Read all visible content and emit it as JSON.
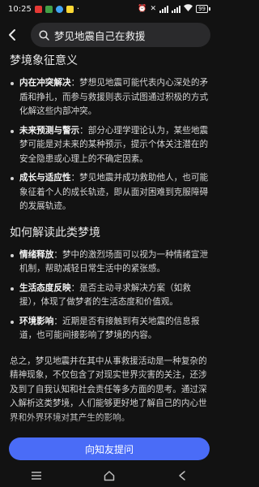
{
  "status": {
    "time": "10:25",
    "battery": "99"
  },
  "search": {
    "query": "梦见地震自己在救援"
  },
  "section1": {
    "title": "梦境象征意义",
    "items": [
      {
        "label": "内在冲突解决",
        "text": "：梦想见地震可能代表内心深处的矛盾和挣扎，而参与救援则表示试图通过积极的方式化解这些内部冲突。"
      },
      {
        "label": "未来预测与警示",
        "text": "：部分心理学理论认为，某些地震梦可能是对未来的某种预示，提示个体关注潜在的安全隐患或心理上的不确定因素。"
      },
      {
        "label": "成长与适应性",
        "text": "：梦见地震并成功救助他人，也可能象征着个人的成长轨迹，即从面对困难到克服障碍的发展轨迹。"
      }
    ]
  },
  "section2": {
    "title": "如何解读此类梦境",
    "items": [
      {
        "label": "情绪释放",
        "text": "：梦中的激烈场面可以视为一种情绪宣泄机制，帮助减轻日常生活中的紧张感。"
      },
      {
        "label": "生活态度反映",
        "text": "：是否主动寻求解决方案（如救援），体现了做梦者的生活态度和价值观。"
      },
      {
        "label": "环境影响",
        "text": "：近期是否有接触到有关地震的信息报道，也可能间接影响了梦境的内容。"
      }
    ]
  },
  "summary": "总之，梦见地震并在其中从事救援活动是一种复杂的精神现象，不仅包含了对现实世界灾害的关注，还涉及到了自我认知和社会责任等多方面的思考。通过深入解析这类梦境，人们能够更好地了解自己的内心世界和外界环境对其产生的影响。",
  "ask_button": "向知友提问",
  "colors": {
    "accent": "#4a6cf7",
    "background": "#121212",
    "search_bg": "#2a2a2c"
  }
}
